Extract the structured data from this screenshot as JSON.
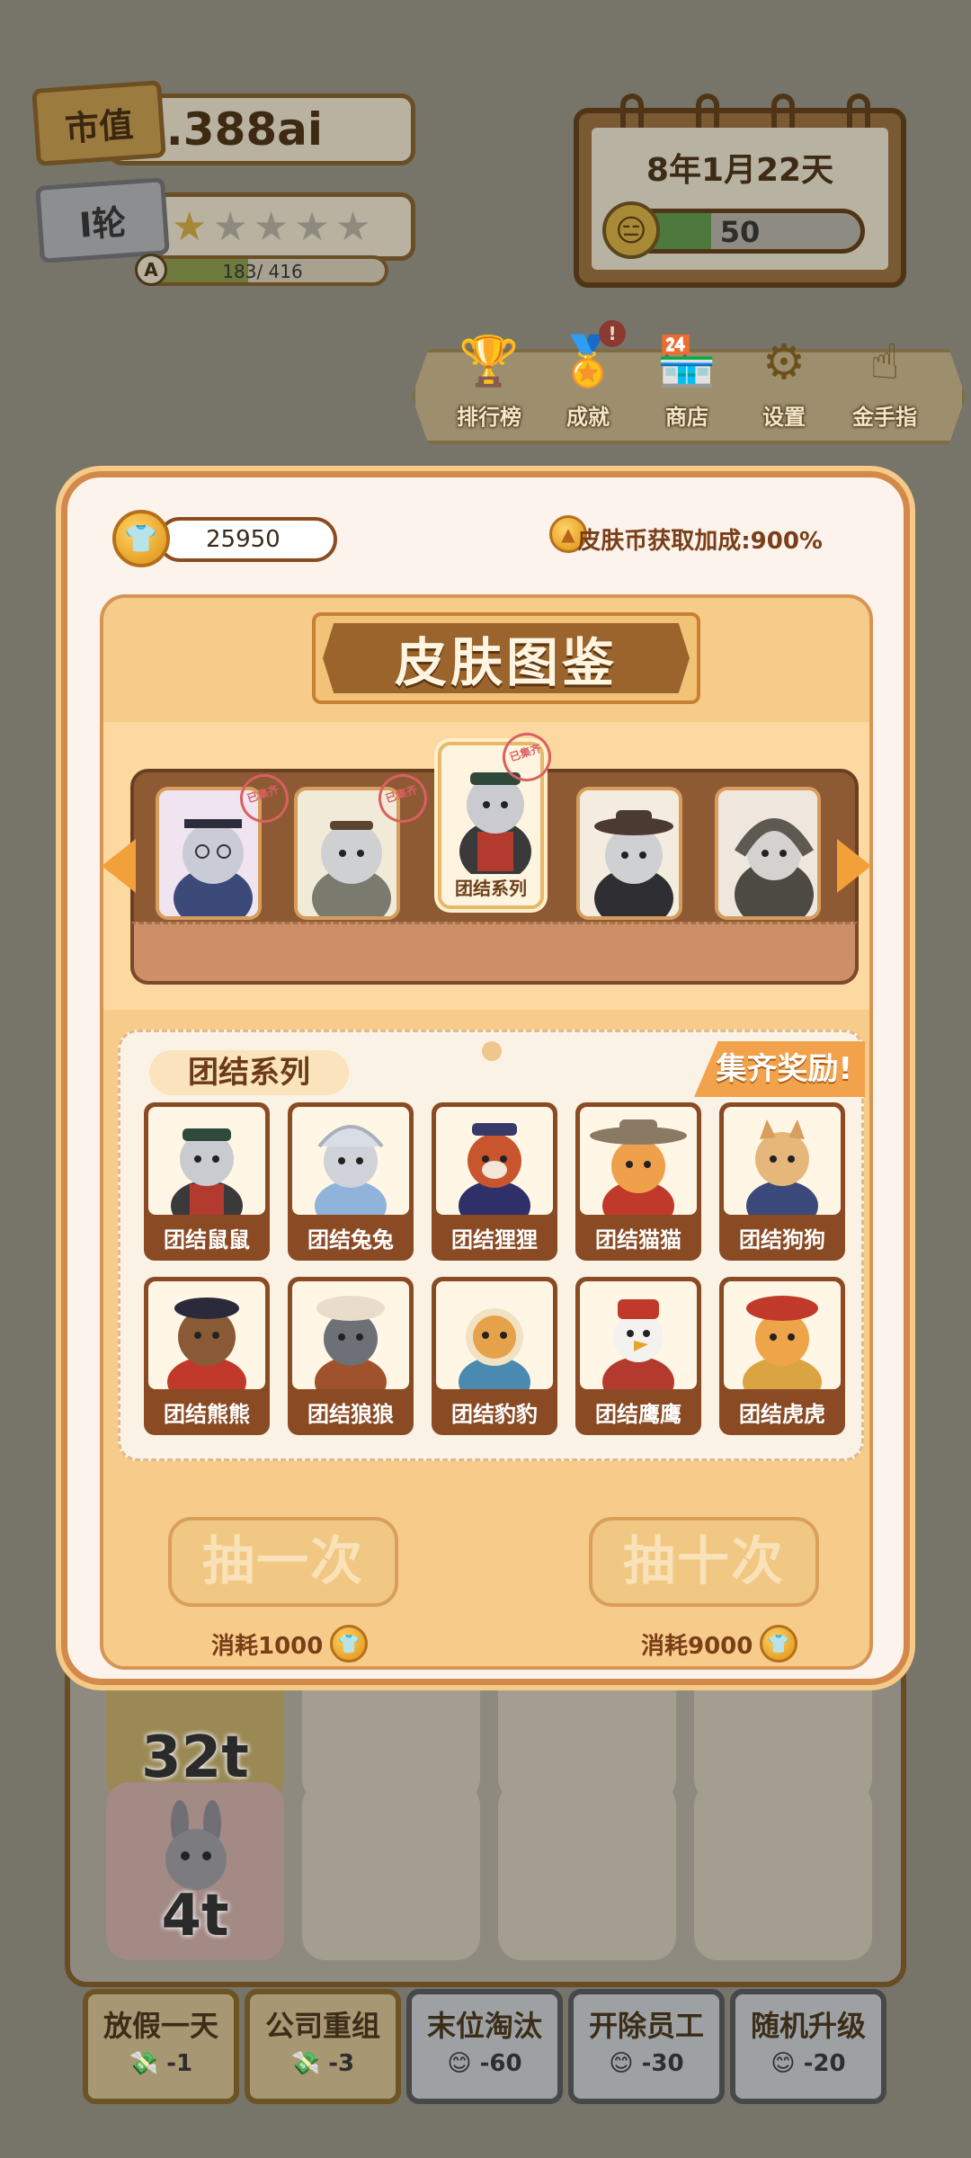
{
  "hud": {
    "market_tag": "市值",
    "market_value": "8.388ai",
    "round_tag": "I轮",
    "stars_on": 1,
    "stars_total": 5,
    "progress_grade": "A",
    "progress_current": "183",
    "progress_total": "/ 416",
    "date": "8年1月22天",
    "mood_value": "50"
  },
  "menu": [
    {
      "label": "排行榜",
      "icon": "trophy-icon"
    },
    {
      "label": "成就",
      "icon": "medal-icon",
      "badge": "!"
    },
    {
      "label": "商店",
      "icon": "shop-icon"
    },
    {
      "label": "设置",
      "icon": "gear-icon"
    },
    {
      "label": "金手指",
      "icon": "pointing-hand-icon"
    }
  ],
  "modal": {
    "coin_amount": "25950",
    "bonus_text": "皮肤币获取加成:900%",
    "title": "皮肤图鉴",
    "carousel_selected_label": "团结系列",
    "stamp_text": "已集齐",
    "series_title": "团结系列",
    "reward_button": "集齐奖励!",
    "items": [
      {
        "label": "团结鼠鼠"
      },
      {
        "label": "团结兔兔"
      },
      {
        "label": "团结狸狸"
      },
      {
        "label": "团结猫猫"
      },
      {
        "label": "团结狗狗"
      },
      {
        "label": "团结熊熊"
      },
      {
        "label": "团结狼狼"
      },
      {
        "label": "团结豹豹"
      },
      {
        "label": "团结鹰鹰"
      },
      {
        "label": "团结虎虎"
      }
    ],
    "draw_one": "抽一次",
    "draw_ten": "抽十次",
    "cost_one": "消耗1000",
    "cost_ten": "消耗9000"
  },
  "board": {
    "cell1_text": "32t",
    "cell2_text": "4t"
  },
  "actions": [
    {
      "label": "放假一天",
      "cost": "-1"
    },
    {
      "label": "公司重组",
      "cost": "-3"
    },
    {
      "label": "末位淘汰",
      "cost": "-60"
    },
    {
      "label": "开除员工",
      "cost": "-30"
    },
    {
      "label": "随机升级",
      "cost": "-20"
    }
  ]
}
